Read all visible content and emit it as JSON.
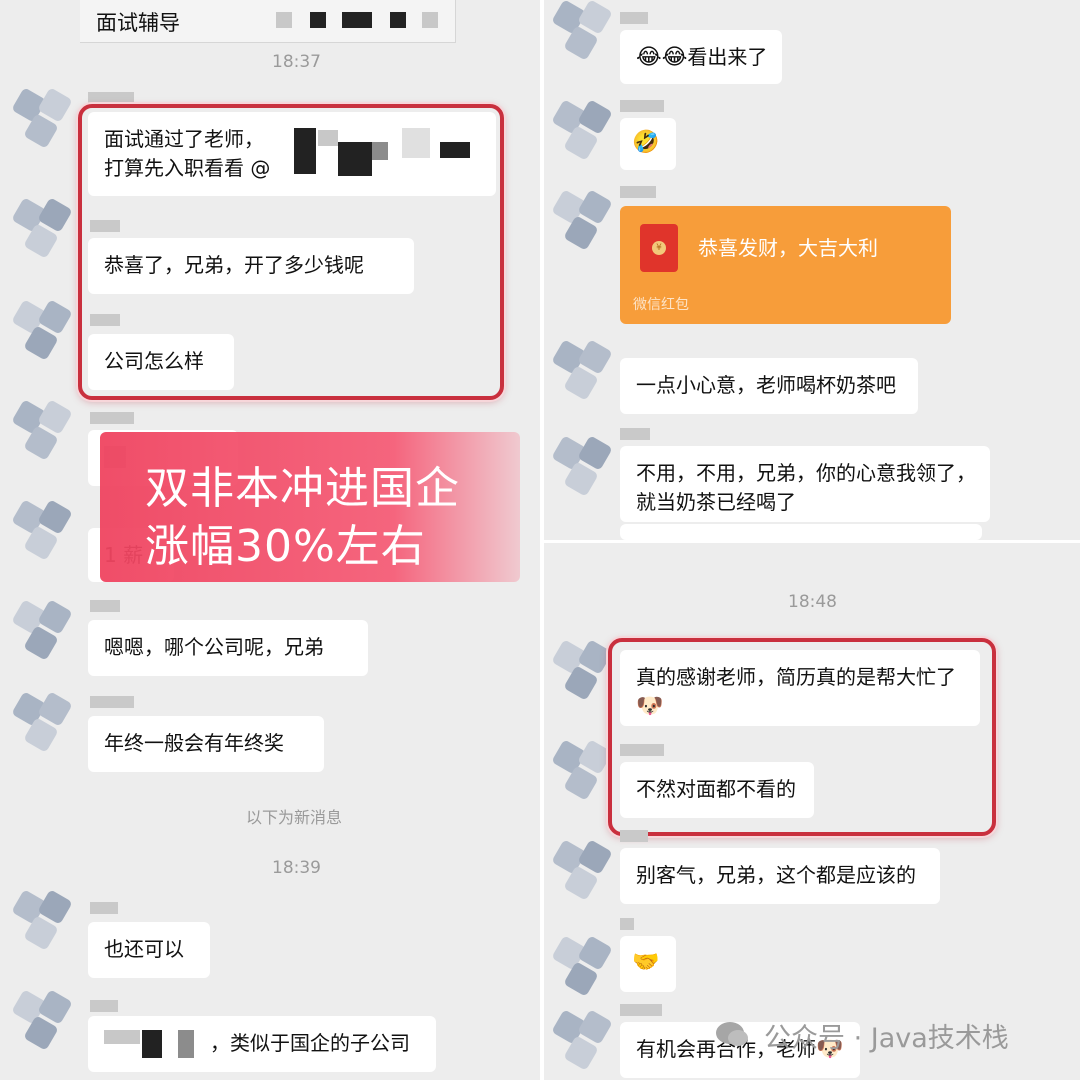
{
  "left": {
    "title": "面试辅导",
    "time1": "18:37",
    "messages": {
      "m1_line1": "面试通过了老师，",
      "m1_line2": "打算先入职看看 @",
      "m2": "恭喜了，兄弟，开了多少钱呢",
      "m3": "公司怎么样",
      "m4_tail": "薪",
      "m4_head": "1",
      "m5": "嗯嗯，哪个公司呢，兄弟",
      "m6": "年终一般会有年终奖",
      "new_msgs": "以下为新消息",
      "time2": "18:39",
      "m7": "也还可以",
      "m8": "，类似于国企的子公司"
    },
    "banner": {
      "line1": "双非本冲进国企",
      "line2": "涨幅30%左右"
    }
  },
  "right": {
    "messages": {
      "r1": "看出来了",
      "redpacket_title": "恭喜发财，大吉大利",
      "redpacket_sub": "微信红包",
      "r2": "一点小心意，老师喝杯奶茶吧",
      "r3_line1": "不用，不用，兄弟，你的心意我领了，",
      "r3_line2": "就当奶茶已经喝了",
      "time3": "18:48",
      "r4_line1": "真的感谢老师，简历真的是帮大忙了",
      "r5": "不然对面都不看的",
      "r6": "别客气，兄弟，这个都是应该的",
      "r7": "有机会再合作，老师"
    },
    "emojis": {
      "r1": "😂😂",
      "laugh": "🤣",
      "doge": "🐶",
      "handshake": "🤝",
      "doge2": "🐶"
    }
  },
  "watermark": "公众号 · Java技术栈"
}
